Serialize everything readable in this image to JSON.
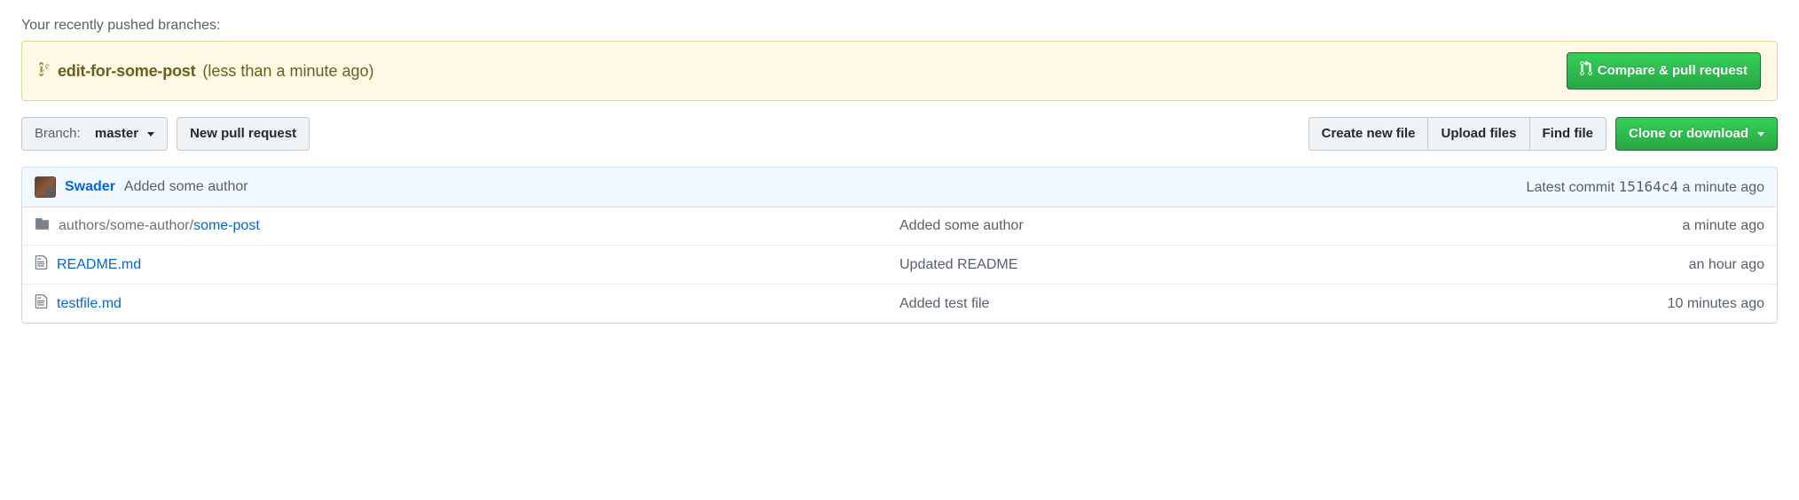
{
  "recent_branches_label": "Your recently pushed branches:",
  "flash": {
    "branch_name": "edit-for-some-post",
    "time_ago": "(less than a minute ago)",
    "compare_button": "Compare & pull request"
  },
  "toolbar": {
    "branch_label": "Branch:",
    "branch_value": "master",
    "new_pr": "New pull request",
    "create_file": "Create new file",
    "upload": "Upload files",
    "find_file": "Find file",
    "clone": "Clone or download"
  },
  "commit_bar": {
    "author": "Swader",
    "message": "Added some author",
    "latest_label": "Latest commit",
    "sha": "15164c4",
    "time_ago": "a minute ago"
  },
  "files": [
    {
      "type": "folder",
      "path_muted": "authors/some-author/",
      "path_link": "some-post",
      "message": "Added some author",
      "time_ago": "a minute ago"
    },
    {
      "type": "file",
      "name": "README.md",
      "message": "Updated README",
      "time_ago": "an hour ago"
    },
    {
      "type": "file",
      "name": "testfile.md",
      "message": "Added test file",
      "time_ago": "10 minutes ago"
    }
  ]
}
